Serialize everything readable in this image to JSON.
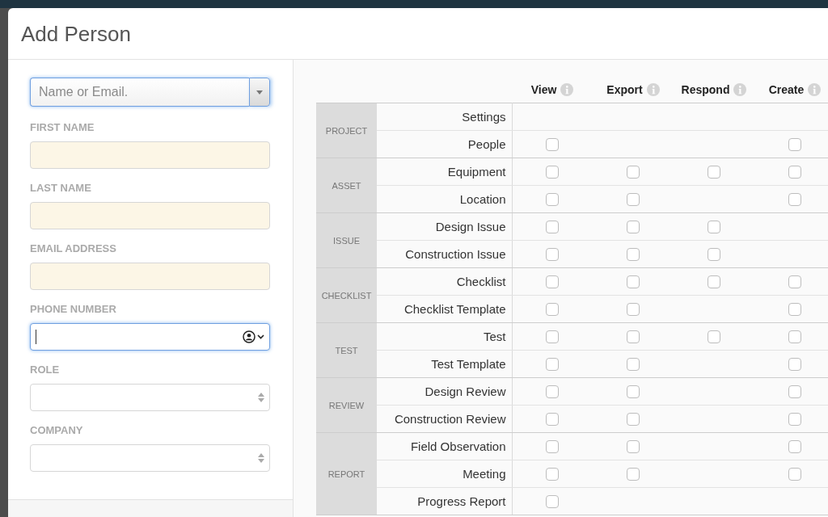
{
  "window": {
    "title": "Add Person"
  },
  "form": {
    "search": {
      "placeholder": "Name or Email.",
      "focused": true
    },
    "fields": [
      {
        "kind": "text",
        "label": "FIRST NAME",
        "highlighted": true,
        "focused": false
      },
      {
        "kind": "text",
        "label": "LAST NAME",
        "highlighted": true,
        "focused": false
      },
      {
        "kind": "text",
        "label": "EMAIL ADDRESS",
        "highlighted": true,
        "focused": false
      },
      {
        "kind": "phone",
        "label": "PHONE NUMBER",
        "highlighted": false,
        "focused": true
      },
      {
        "kind": "select",
        "label": "ROLE",
        "highlighted": false,
        "focused": false
      },
      {
        "kind": "select",
        "label": "COMPANY",
        "highlighted": false,
        "focused": false
      }
    ]
  },
  "permissions": {
    "columns": [
      {
        "label": "View"
      },
      {
        "label": "Export"
      },
      {
        "label": "Respond"
      },
      {
        "label": "Create"
      }
    ],
    "groups": [
      {
        "label": "PROJECT",
        "items": [
          {
            "label": "Settings",
            "cells": [
              {
                "kind": "blank"
              },
              {
                "kind": "blank"
              },
              {
                "kind": "blank"
              },
              {
                "kind": "blank"
              }
            ]
          },
          {
            "label": "People",
            "cells": [
              {
                "kind": "checkbox",
                "checked": false
              },
              {
                "kind": "blank"
              },
              {
                "kind": "blank"
              },
              {
                "kind": "checkbox",
                "checked": false
              }
            ]
          }
        ]
      },
      {
        "label": "ASSET",
        "items": [
          {
            "label": "Equipment",
            "cells": [
              {
                "kind": "checkbox",
                "checked": false
              },
              {
                "kind": "checkbox",
                "checked": false
              },
              {
                "kind": "checkbox",
                "checked": false
              },
              {
                "kind": "checkbox",
                "checked": false
              }
            ]
          },
          {
            "label": "Location",
            "cells": [
              {
                "kind": "checkbox",
                "checked": false
              },
              {
                "kind": "checkbox",
                "checked": false
              },
              {
                "kind": "blank"
              },
              {
                "kind": "checkbox",
                "checked": false
              }
            ]
          }
        ]
      },
      {
        "label": "ISSUE",
        "items": [
          {
            "label": "Design Issue",
            "cells": [
              {
                "kind": "checkbox",
                "checked": false
              },
              {
                "kind": "checkbox",
                "checked": false
              },
              {
                "kind": "checkbox",
                "checked": false
              },
              {
                "kind": "blank"
              }
            ]
          },
          {
            "label": "Construction Issue",
            "cells": [
              {
                "kind": "checkbox",
                "checked": false
              },
              {
                "kind": "checkbox",
                "checked": false
              },
              {
                "kind": "checkbox",
                "checked": false
              },
              {
                "kind": "blank"
              }
            ]
          }
        ]
      },
      {
        "label": "CHECKLIST",
        "items": [
          {
            "label": "Checklist",
            "cells": [
              {
                "kind": "checkbox",
                "checked": false
              },
              {
                "kind": "checkbox",
                "checked": false
              },
              {
                "kind": "checkbox",
                "checked": false
              },
              {
                "kind": "checkbox",
                "checked": false
              }
            ]
          },
          {
            "label": "Checklist Template",
            "cells": [
              {
                "kind": "checkbox",
                "checked": false
              },
              {
                "kind": "checkbox",
                "checked": false
              },
              {
                "kind": "blank"
              },
              {
                "kind": "checkbox",
                "checked": false
              }
            ]
          }
        ]
      },
      {
        "label": "TEST",
        "items": [
          {
            "label": "Test",
            "cells": [
              {
                "kind": "checkbox",
                "checked": false
              },
              {
                "kind": "checkbox",
                "checked": false
              },
              {
                "kind": "checkbox",
                "checked": false
              },
              {
                "kind": "checkbox",
                "checked": false
              }
            ]
          },
          {
            "label": "Test Template",
            "cells": [
              {
                "kind": "checkbox",
                "checked": false
              },
              {
                "kind": "checkbox",
                "checked": false
              },
              {
                "kind": "blank"
              },
              {
                "kind": "checkbox",
                "checked": false
              }
            ]
          }
        ]
      },
      {
        "label": "REVIEW",
        "items": [
          {
            "label": "Design Review",
            "cells": [
              {
                "kind": "checkbox",
                "checked": false
              },
              {
                "kind": "checkbox",
                "checked": false
              },
              {
                "kind": "blank"
              },
              {
                "kind": "checkbox",
                "checked": false
              }
            ]
          },
          {
            "label": "Construction Review",
            "cells": [
              {
                "kind": "checkbox",
                "checked": false
              },
              {
                "kind": "checkbox",
                "checked": false
              },
              {
                "kind": "blank"
              },
              {
                "kind": "checkbox",
                "checked": false
              }
            ]
          }
        ]
      },
      {
        "label": "REPORT",
        "items": [
          {
            "label": "Field Observation",
            "cells": [
              {
                "kind": "checkbox",
                "checked": false
              },
              {
                "kind": "checkbox",
                "checked": false
              },
              {
                "kind": "blank"
              },
              {
                "kind": "checkbox",
                "checked": false
              }
            ]
          },
          {
            "label": "Meeting",
            "cells": [
              {
                "kind": "checkbox",
                "checked": false
              },
              {
                "kind": "checkbox",
                "checked": false
              },
              {
                "kind": "blank"
              },
              {
                "kind": "checkbox",
                "checked": false
              }
            ]
          },
          {
            "label": "Progress Report",
            "cells": [
              {
                "kind": "checkbox",
                "checked": false
              },
              {
                "kind": "blank"
              },
              {
                "kind": "blank"
              },
              {
                "kind": "blank"
              }
            ]
          }
        ]
      }
    ]
  }
}
